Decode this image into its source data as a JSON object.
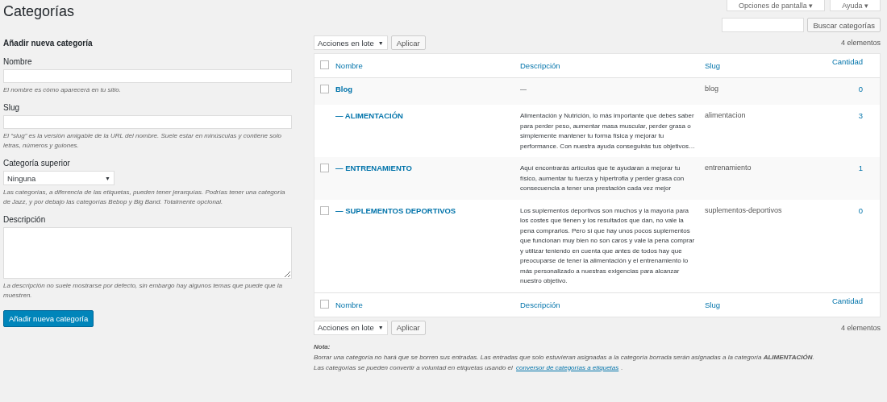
{
  "title": "Categorías",
  "top_buttons": [
    {
      "label": "Opciones de pantalla",
      "caret": "▾"
    },
    {
      "label": "Ayuda",
      "caret": "▾"
    }
  ],
  "dropdown_arrow": "▼",
  "search": {
    "button": "Buscar categorías"
  },
  "form": {
    "heading": "Añadir nueva categoría",
    "name": {
      "label": "Nombre",
      "hint": "El nombre es cómo aparecerá en tu sitio."
    },
    "slug": {
      "label": "Slug",
      "hint": "El “slug” es la versión amigable de la URL del nombre. Suele estar en minúsculas y contiene solo letras, números y guiones."
    },
    "parent": {
      "label": "Categoría superior",
      "value": "Ninguna",
      "hint": "Las categorías, a diferencia de las etiquetas, pueden tener jerarquías. Podrías tener una categoría de Jazz, y por debajo las categorías Bebop y Big Band. Totalmente opcional."
    },
    "description": {
      "label": "Descripción",
      "hint": "La descripción no suele mostrarse por defecto, sin embargo hay algunos temas que puede que la muestren."
    },
    "submit": "Añadir nueva categoría"
  },
  "bulk_top": {
    "action": "Acciones en lote",
    "apply": "Aplicar",
    "count": "4 elementos"
  },
  "table": {
    "select_all_checked": false,
    "footer_select_all_checked": false,
    "columns": [
      "Nombre",
      "Descripción",
      "Slug",
      "Cantidad"
    ],
    "rows": [
      {
        "name": "Blog",
        "checkbox": {
          "checked": false
        },
        "description": "—",
        "slug": "blog",
        "count": "0"
      },
      {
        "name": "— ALIMENTACIÓN",
        "description": "Alimentación y Nutrición, lo más importante que debes saber para perder peso, aumentar masa muscular, perder grasa o simplemente mantener tu forma física y mejorar tu performance. Con nuestra ayuda conseguirás tus objetivos…",
        "slug": "alimentacion",
        "count": "3"
      },
      {
        "name": "— ENTRENAMIENTO",
        "checkbox": {
          "checked": false
        },
        "description": "Aquí encontrarás artículos que te ayudaran a mejorar tu físico, aumentar tu fuerza y hipertrofia y perder grasa con consecuencia a tener una prestación cada vez mejor",
        "slug": "entrenamiento",
        "count": "1"
      },
      {
        "name": "— SUPLEMENTOS DEPORTIVOS",
        "checkbox": {
          "checked": false
        },
        "description": "Los suplementos deportivos son muchos y la mayoría para los costes que tienen y los resultados que dan, no vale la pena comprarlos. Pero sí que hay unos pocos suplementos que funcionan muy bien no son caros y vale la pena comprar y utilizar teniendo en cuenta que antes de todos hay que preocuparse de tener la alimentación y el entrenamiento lo más personalizado a nuestras exigencias para alcanzar nuestro objetivo.",
        "slug": "suplementos-deportivos",
        "count": "0"
      }
    ],
    "footer_columns": [
      "Nombre",
      "Descripción",
      "Slug",
      "Cantidad"
    ]
  },
  "bulk_bottom": {
    "action": "Acciones en lote",
    "apply": "Aplicar",
    "count": "4 elementos"
  },
  "note": {
    "title": "Nota:",
    "text": "Borrar una categoría no hará que se borren sus entradas. Las entradas que solo estuvieran asignadas a la categoría borrada serán asignadas a la categoría **ALIMENTACIÓN**.",
    "convert_text": "Las categorías se pueden convertir a voluntad en etiquetas usando el",
    "convert_link": "conversor de categorías a etiquetas",
    "convert_end": "."
  }
}
